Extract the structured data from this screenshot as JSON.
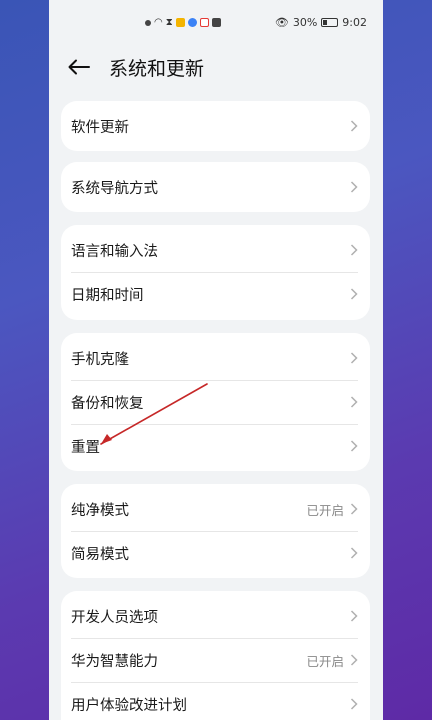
{
  "status_bar": {
    "battery": "30%",
    "time": "9:02",
    "icons": [
      "notification-icon",
      "wifi-icon",
      "hourglass-icon",
      "app-icon",
      "app-icon",
      "app-icon",
      "mail-icon",
      "eye-icon",
      "battery-icon"
    ]
  },
  "header": {
    "title": "系统和更新",
    "back_icon": "back-arrow-icon"
  },
  "groups": [
    {
      "items": [
        {
          "label": "软件更新",
          "value": ""
        }
      ]
    },
    {
      "items": [
        {
          "label": "系统导航方式",
          "value": ""
        }
      ]
    },
    {
      "items": [
        {
          "label": "语言和输入法",
          "value": ""
        },
        {
          "label": "日期和时间",
          "value": ""
        }
      ]
    },
    {
      "items": [
        {
          "label": "手机克隆",
          "value": ""
        },
        {
          "label": "备份和恢复",
          "value": ""
        },
        {
          "label": "重置",
          "value": ""
        }
      ]
    },
    {
      "items": [
        {
          "label": "纯净模式",
          "value": "已开启"
        },
        {
          "label": "简易模式",
          "value": ""
        }
      ]
    },
    {
      "items": [
        {
          "label": "开发人员选项",
          "value": ""
        },
        {
          "label": "华为智慧能力",
          "value": "已开启"
        },
        {
          "label": "用户体验改进计划",
          "value": ""
        }
      ]
    }
  ],
  "colors": {
    "annotation": "#c62828",
    "background": "#f1f3f5"
  }
}
